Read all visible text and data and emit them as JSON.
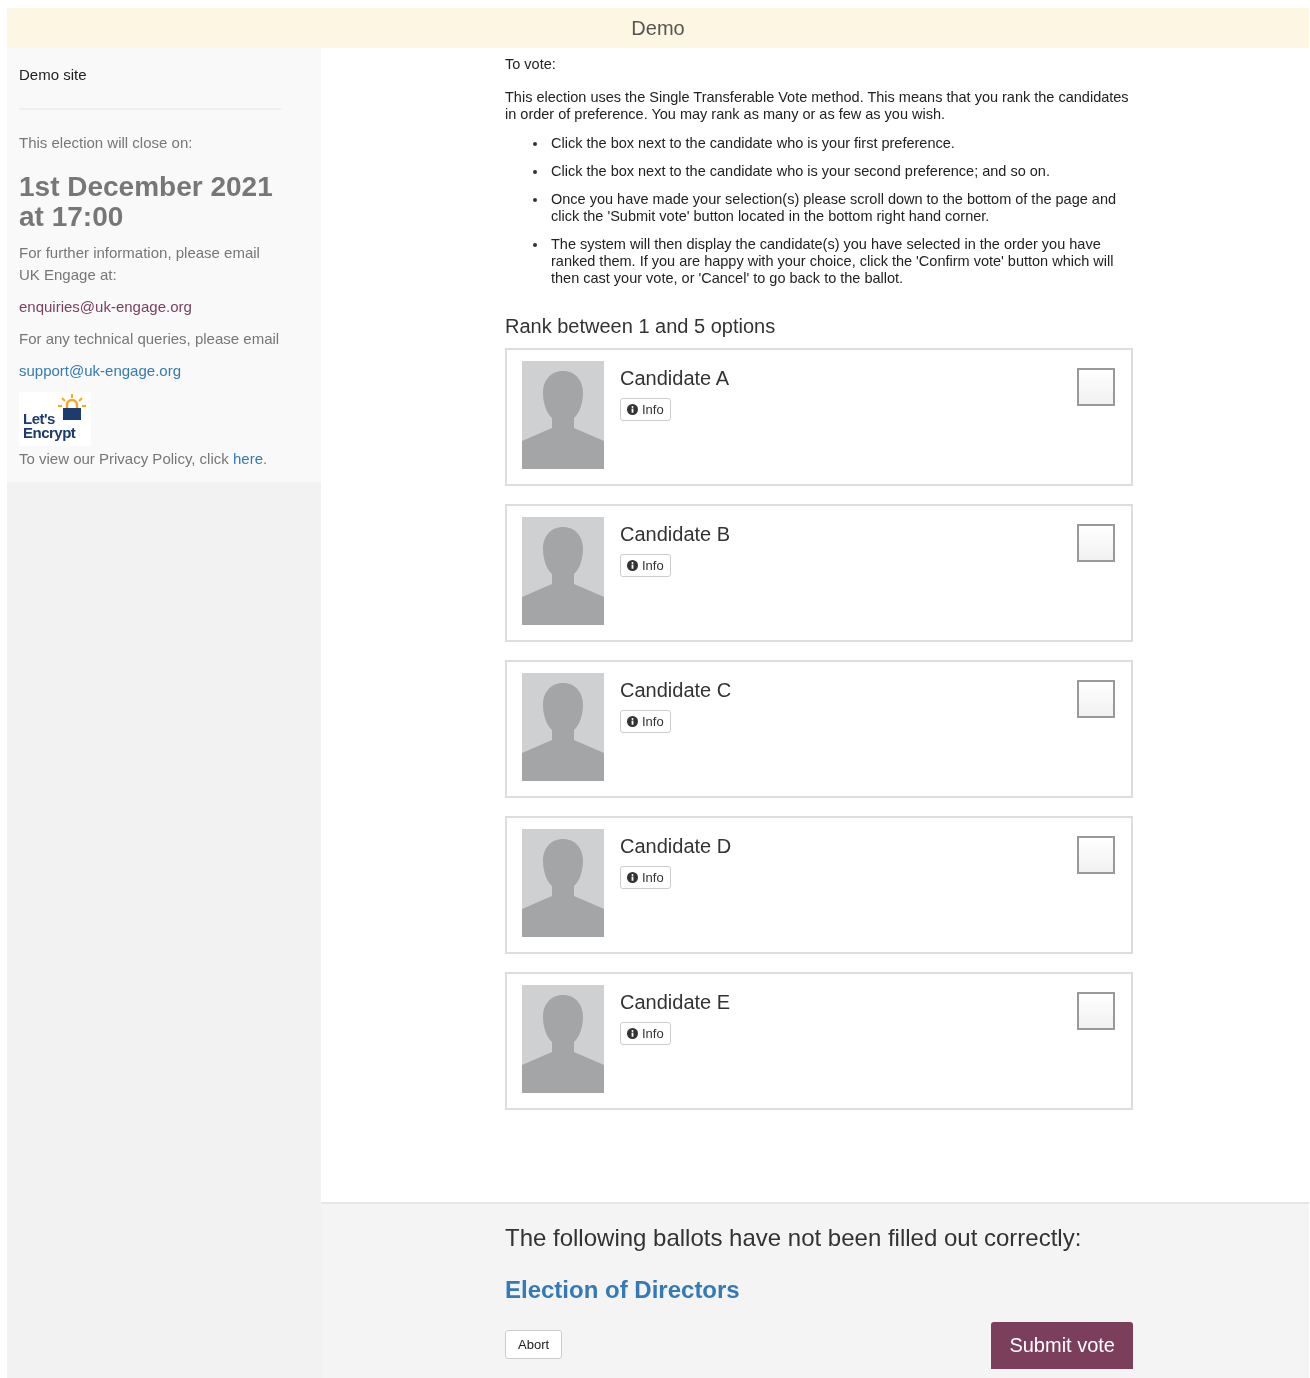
{
  "banner": {
    "title": "Demo"
  },
  "sidebar": {
    "site_name": "Demo site",
    "close_label": "This election will close on:",
    "close_date": "1st December 2021 at 17:00",
    "info_text": "For further information, please email UK Engage at:",
    "info_email": "enquiries@uk-engage.org",
    "tech_text": "For any technical queries, please email",
    "tech_email": "support@uk-engage.org",
    "logo": {
      "line_1": "Let's",
      "line_2": "Encrypt"
    },
    "privacy": {
      "text": "To view our Privacy Policy, click ",
      "link": "here",
      "end": "."
    }
  },
  "instructions": {
    "heading": "To vote:",
    "intro": "This election uses the Single Transferable Vote method. This means that you rank the candidates in order of preference. You may rank as many or as few as you wish.",
    "steps": [
      "Click the box next to the candidate who is your first preference.",
      "Click the box next to the candidate who is your second preference; and so on.",
      "Once you have made your selection(s) please scroll down to the bottom of the page and click the 'Submit vote' button located in the bottom right hand corner.",
      "The system will then display the candidate(s) you have selected in the order you have ranked them. If you are happy with your choice, click the 'Confirm vote' button which will then cast your vote, or 'Cancel' to go back to the ballot."
    ]
  },
  "ballot": {
    "title": "Rank between 1 and 5 options",
    "candidates": [
      {
        "name": "Candidate A",
        "info": "Info",
        "checked": false
      },
      {
        "name": "Candidate B",
        "info": "Info",
        "checked": false
      },
      {
        "name": "Candidate C",
        "info": "Info",
        "checked": false
      },
      {
        "name": "Candidate D",
        "info": "Info",
        "checked": false
      },
      {
        "name": "Candidate E",
        "info": "Info",
        "checked": false
      }
    ]
  },
  "footer": {
    "message": "The following ballots have not been filled out correctly:",
    "election": "Election of Directors",
    "abort": "Abort",
    "submit": "Submit vote"
  }
}
